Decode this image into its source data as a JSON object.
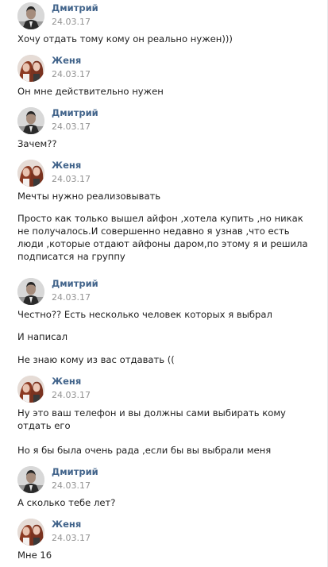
{
  "messages": [
    {
      "author": "Дмитрий",
      "date": "24.03.17",
      "avatar_icon": "dmitry-avatar",
      "lines": [
        "Хочу отдать тому кому он реально нужен)))"
      ]
    },
    {
      "author": "Женя",
      "date": "24.03.17",
      "avatar_icon": "zhenya-avatar",
      "lines": [
        "Он мне действительно нужен"
      ]
    },
    {
      "author": "Дмитрий",
      "date": "24.03.17",
      "avatar_icon": "dmitry-avatar",
      "lines": [
        "Зачем??"
      ]
    },
    {
      "author": "Женя",
      "date": "24.03.17",
      "avatar_icon": "zhenya-avatar",
      "lines": [
        "Мечты нужно реализовывать",
        "Просто как только вышел айфон ,хотела купить ,но никак не получалось.И совершенно недавно я узнав ,что есть люди ,которые отдают айфоны даром,по этому я и решила подписатся на группу"
      ]
    },
    {
      "author": "Дмитрий",
      "date": "24.03.17",
      "avatar_icon": "dmitry-avatar",
      "lines": [
        "Честно?? Есть несколько человек которых я выбрал",
        "И написал",
        "Не знаю кому из вас отдавать (("
      ]
    },
    {
      "author": "Женя",
      "date": "24.03.17",
      "avatar_icon": "zhenya-avatar",
      "lines": [
        "Ну это ваш телефон и вы должны сами выбирать кому отдать его",
        "Но я бы была очень рада ,если бы вы выбрали меня"
      ]
    },
    {
      "author": "Дмитрий",
      "date": "24.03.17",
      "avatar_icon": "dmitry-avatar",
      "lines": [
        "А сколько тебе лет?"
      ]
    },
    {
      "author": "Женя",
      "date": "24.03.17",
      "avatar_icon": "zhenya-avatar",
      "lines": [
        "Мне 16"
      ]
    }
  ],
  "colors": {
    "author": "#42648b",
    "date": "#939393",
    "text": "#1e1e1e"
  }
}
